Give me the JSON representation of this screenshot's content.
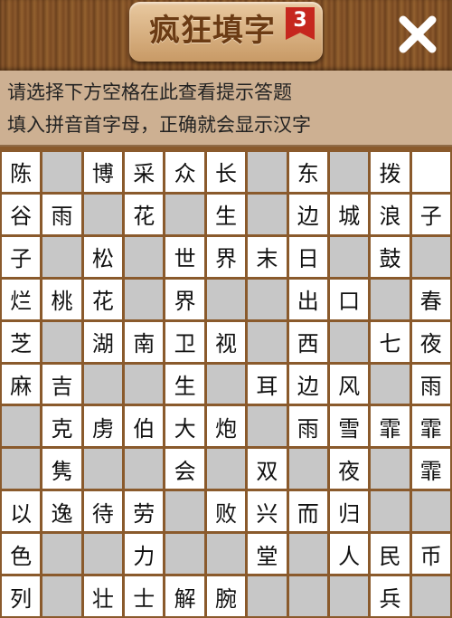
{
  "header": {
    "title": "疯狂填字",
    "level": "3"
  },
  "hint": {
    "line1": "请选择下方空格在此查看提示答题",
    "line2": "填入拼音首字母，正确就会显示汉字"
  },
  "grid": {
    "rows": [
      [
        "陈",
        "#",
        "博",
        "采",
        "众",
        "长",
        "#",
        "东",
        "#",
        "拨",
        ""
      ],
      [
        "谷",
        "雨",
        "#",
        "花",
        "#",
        "生",
        "#",
        "边",
        "城",
        "浪",
        "子"
      ],
      [
        "子",
        "#",
        "松",
        "#",
        "世",
        "界",
        "末",
        "日",
        "#",
        "鼓",
        "#"
      ],
      [
        "烂",
        "桃",
        "花",
        "#",
        "界",
        "#",
        "#",
        "出",
        "口",
        "#",
        "春"
      ],
      [
        "芝",
        "#",
        "湖",
        "南",
        "卫",
        "视",
        "#",
        "西",
        "#",
        "七",
        "夜"
      ],
      [
        "麻",
        "吉",
        "#",
        "#",
        "生",
        "#",
        "耳",
        "边",
        "风",
        "#",
        "雨"
      ],
      [
        "#",
        "克",
        "虏",
        "伯",
        "大",
        "炮",
        "#",
        "雨",
        "雪",
        "霏",
        "霏"
      ],
      [
        "#",
        "隽",
        "#",
        "#",
        "会",
        "#",
        "双",
        "#",
        "夜",
        "#",
        "霏"
      ],
      [
        "以",
        "逸",
        "待",
        "劳",
        "#",
        "败",
        "兴",
        "而",
        "归",
        "#",
        "#"
      ],
      [
        "色",
        "#",
        "#",
        "力",
        "#",
        "#",
        "堂",
        "#",
        "人",
        "民",
        "币"
      ],
      [
        "列",
        "#",
        "壮",
        "士",
        "解",
        "腕",
        "#",
        "#",
        "#",
        "兵",
        "#"
      ]
    ]
  }
}
